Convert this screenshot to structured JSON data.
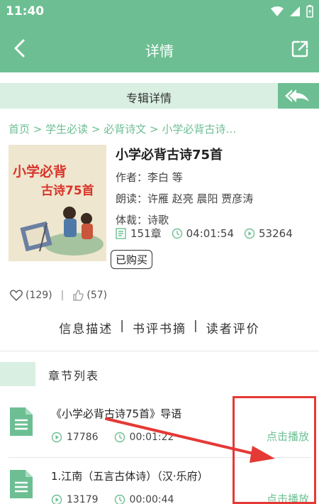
{
  "status_bar": {
    "time": "11:40"
  },
  "app_bar": {
    "title": "详情"
  },
  "album_bar": {
    "label": "专辑详情"
  },
  "breadcrumb": "首页 > 学生必读 > 必背诗文 > 小学必背古诗…",
  "book": {
    "title": "小学必背古诗75首",
    "author": "作者：李白 等",
    "narrator": "朗读：许雁 赵亮 晨阳 贾彦涛",
    "genre": "体裁：诗歌",
    "chapters": "151章",
    "duration": "04:01:54",
    "plays": "53264",
    "purchased": "已购买",
    "cover_line1": "小学必背",
    "cover_line2": "古诗75首"
  },
  "social": {
    "favorites": "(129)",
    "likes": "(57)"
  },
  "tabs": [
    "信息描述",
    "书评书摘",
    "读者评价"
  ],
  "chapters_header": "章节列表",
  "chapters": [
    {
      "title": "《小学必背古诗75首》导语",
      "plays": "17786",
      "duration": "00:01:22",
      "play_label": "点击播放"
    },
    {
      "title": "1.江南（五言古体诗）（汉·乐府）",
      "plays": "13179",
      "duration": "00:00:44",
      "play_label": "点击播放"
    }
  ],
  "colors": {
    "primary": "#6dbf93",
    "light": "#d9efe2",
    "annotation": "#e53935"
  }
}
